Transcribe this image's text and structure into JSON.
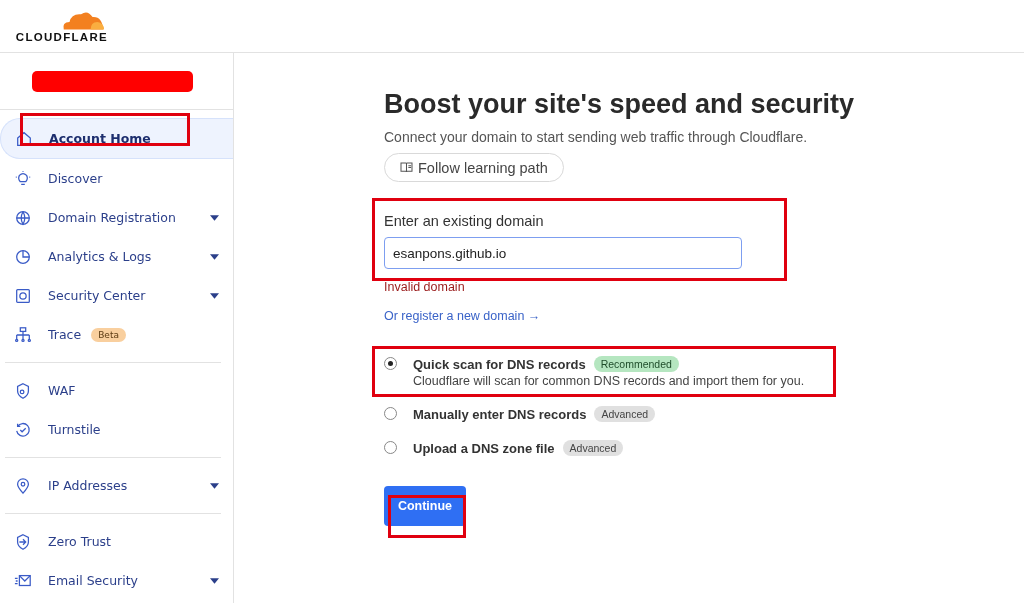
{
  "header": {
    "logo_text": "CLOUDFLARE"
  },
  "sidebar": {
    "groups": [
      [
        {
          "label": "Account Home",
          "selected": true,
          "expandable": false
        },
        {
          "label": "Discover",
          "selected": false,
          "expandable": false
        },
        {
          "label": "Domain Registration",
          "selected": false,
          "expandable": true
        },
        {
          "label": "Analytics & Logs",
          "selected": false,
          "expandable": true
        },
        {
          "label": "Security Center",
          "selected": false,
          "expandable": true
        },
        {
          "label": "Trace",
          "selected": false,
          "expandable": false,
          "badge": "Beta"
        }
      ],
      [
        {
          "label": "WAF",
          "selected": false,
          "expandable": false
        },
        {
          "label": "Turnstile",
          "selected": false,
          "expandable": false
        }
      ],
      [
        {
          "label": "IP Addresses",
          "selected": false,
          "expandable": true
        }
      ],
      [
        {
          "label": "Zero Trust",
          "selected": false,
          "expandable": false
        },
        {
          "label": "Email Security",
          "selected": false,
          "expandable": true
        }
      ]
    ]
  },
  "main": {
    "title": "Boost your site's speed and security",
    "subtitle": "Connect your domain to start sending web traffic through Cloudflare.",
    "learning_button": "Follow learning path",
    "domain_label": "Enter an existing domain",
    "domain_value": "esanpons.github.io",
    "error": "Invalid domain",
    "register_link": "Or register a new domain →",
    "options": [
      {
        "label": "Quick scan for DNS records",
        "selected": true,
        "badge": {
          "text": "Recommended",
          "kind": "recommended"
        },
        "description": "Cloudflare will scan for common DNS records and import them for you."
      },
      {
        "label": "Manually enter DNS records",
        "selected": false,
        "badge": {
          "text": "Advanced",
          "kind": "advanced"
        }
      },
      {
        "label": "Upload a DNS zone file",
        "selected": false,
        "badge": {
          "text": "Advanced",
          "kind": "advanced"
        }
      }
    ],
    "continue_button": "Continue"
  }
}
